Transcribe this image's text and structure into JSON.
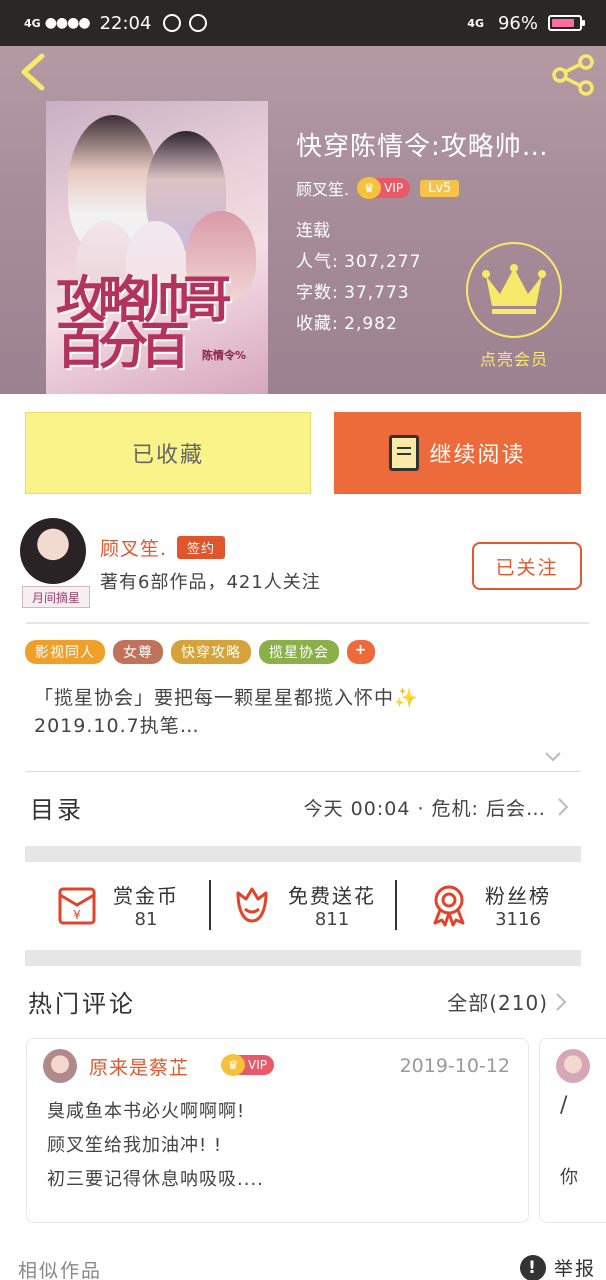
{
  "status_bar": {
    "network": "4G",
    "time": "22:04",
    "network_right": "4G",
    "battery": "96%"
  },
  "book": {
    "title": "快穿陈情令:攻略帅…",
    "author": "顾叉笙.",
    "vip_label": "VIP",
    "level": "Lv5",
    "status": "连载",
    "popularity_label": "人气:",
    "popularity": "307,277",
    "words_label": "字数:",
    "words": "37,773",
    "favorites_label": "收藏:",
    "favorites": "2,982",
    "cover_title": "攻略帅哥百分百",
    "cover_subtitle": "陈情令%"
  },
  "member": {
    "label": "点亮会员"
  },
  "buttons": {
    "favorited": "已收藏",
    "continue_reading": "继续阅读"
  },
  "author_section": {
    "name": "顾叉笙.",
    "sign_tag": "签约",
    "desc": "著有6部作品，421人关注",
    "follow": "已关注",
    "badge": "月间摘星"
  },
  "tags": [
    {
      "label": "影视同人",
      "color": "#f0a02a"
    },
    {
      "label": "女尊",
      "color": "#c0735a"
    },
    {
      "label": "快穿攻略",
      "color": "#d6a23a"
    },
    {
      "label": "揽星协会",
      "color": "#8bb04a"
    },
    {
      "label": "+",
      "color": "#ed6a3a"
    }
  ],
  "intro": {
    "line1": "「揽星协会」要把每一颗星星都揽入怀中",
    "sparkle": "✨",
    "line2": "2019.10.7执笔…"
  },
  "toc": {
    "title": "目录",
    "latest": "今天 00:04 · 危机: 后会…"
  },
  "actions": [
    {
      "label": "赏金币",
      "count": "81",
      "icon": "red-envelope-icon"
    },
    {
      "label": "免费送花",
      "count": "811",
      "icon": "flower-icon"
    },
    {
      "label": "粉丝榜",
      "count": "3116",
      "icon": "medal-icon"
    }
  ],
  "hot_comments": {
    "title": "热门评论",
    "all": "全部(210)"
  },
  "comment": {
    "user": "原来是蔡芷",
    "vip": "VIP",
    "date": "2019-10-12",
    "lines": [
      "臭咸鱼本书必火啊啊啊!",
      "顾叉笙给我加油冲! !",
      "初三要记得休息呐吸吸...."
    ]
  },
  "comment2": {
    "line1": "/",
    "line2": "你"
  },
  "footer": {
    "similar": "相似作品",
    "report": "举报"
  },
  "colors": {
    "accent": "#ed6a3a",
    "favorite_bg": "#faf38a",
    "hero_bg": "#a78d99"
  }
}
